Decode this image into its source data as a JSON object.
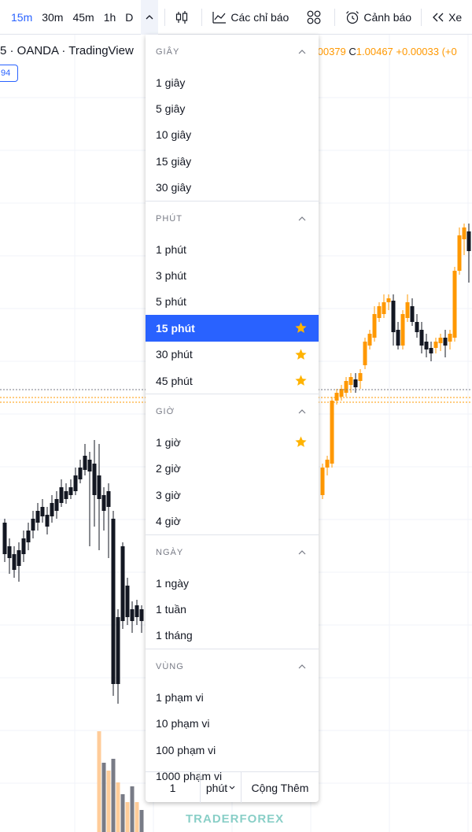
{
  "toolbar": {
    "timeframes": [
      {
        "label": "15m",
        "active": true
      },
      {
        "label": "30m",
        "active": false
      },
      {
        "label": "45m",
        "active": false
      },
      {
        "label": "1h",
        "active": false
      },
      {
        "label": "D",
        "active": false
      }
    ],
    "chevron_icon": "chevron-up-icon",
    "candles_icon": "candlestick-icon",
    "indicators_label": "Các chỉ báo",
    "templates_icon": "templates-grid-icon",
    "alerts_label": "Cảnh báo",
    "replay_label": "Xe"
  },
  "legend": {
    "symbol_text": "5 · OANDA · TradingView",
    "ohlc_partial_value": ".00379",
    "close_key": "C",
    "close_value": "1.00467",
    "change_value": "+0.00033 (+0",
    "badge_text": "94"
  },
  "dropdown": {
    "sections": [
      {
        "title": "GIÂY",
        "items": [
          {
            "label": "1 giây",
            "starred": false,
            "selected": false
          },
          {
            "label": "5 giây",
            "starred": false,
            "selected": false
          },
          {
            "label": "10 giây",
            "starred": false,
            "selected": false
          },
          {
            "label": "15 giây",
            "starred": false,
            "selected": false
          },
          {
            "label": "30 giây",
            "starred": false,
            "selected": false
          }
        ]
      },
      {
        "title": "PHÚT",
        "items": [
          {
            "label": "1 phút",
            "starred": false,
            "selected": false
          },
          {
            "label": "3 phút",
            "starred": false,
            "selected": false
          },
          {
            "label": "5 phút",
            "starred": false,
            "selected": false
          },
          {
            "label": "15 phút",
            "starred": true,
            "selected": true
          },
          {
            "label": "30 phút",
            "starred": true,
            "selected": false
          },
          {
            "label": "45 phút",
            "starred": true,
            "selected": false
          }
        ]
      },
      {
        "title": "GIỜ",
        "items": [
          {
            "label": "1 giờ",
            "starred": true,
            "selected": false
          },
          {
            "label": "2 giờ",
            "starred": false,
            "selected": false
          },
          {
            "label": "3 giờ",
            "starred": false,
            "selected": false
          },
          {
            "label": "4 giờ",
            "starred": false,
            "selected": false
          }
        ]
      },
      {
        "title": "NGÀY",
        "items": [
          {
            "label": "1 ngày",
            "starred": false,
            "selected": false
          },
          {
            "label": "1 tuần",
            "starred": false,
            "selected": false
          },
          {
            "label": "1 tháng",
            "starred": false,
            "selected": false
          }
        ]
      },
      {
        "title": "VÙNG",
        "items": [
          {
            "label": "1 phạm vi",
            "starred": false,
            "selected": false
          },
          {
            "label": "10 phạm vi",
            "starred": false,
            "selected": false
          },
          {
            "label": "100 phạm vi",
            "starred": false,
            "selected": false
          },
          {
            "label": "1000 phạm vi",
            "starred": false,
            "selected": false
          }
        ]
      }
    ],
    "custom": {
      "value": "1",
      "unit_label": "phút",
      "add_label": "Cộng Thêm"
    }
  },
  "watermark": {
    "left": "TRADER",
    "right": "FOREX"
  },
  "colors": {
    "accent": "#2962ff",
    "bull": "#ff9800",
    "bear": "#131722",
    "star": "#ffb300",
    "volume_bull": "#ffcc99",
    "volume_bear": "#787b86"
  },
  "chart_data": {
    "type": "candlestick",
    "visible_candles": "left and right of dropdown",
    "current_price_line": "dotted"
  }
}
